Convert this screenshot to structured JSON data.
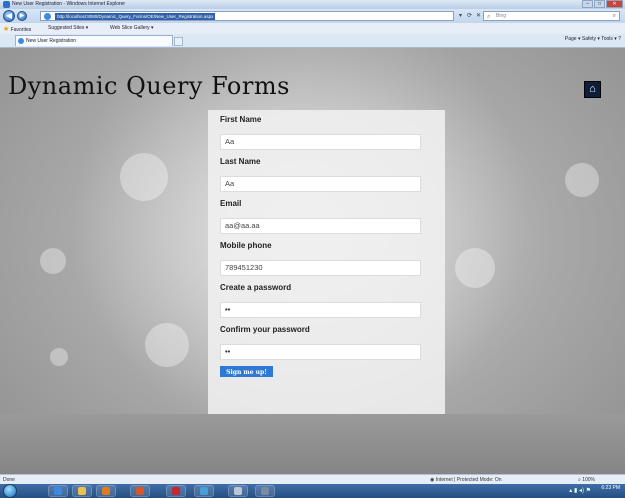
{
  "window": {
    "title": "New User Registration - Windows Internet Explorer",
    "controls": {
      "minimize": "–",
      "maximize": "□",
      "close": "✕"
    }
  },
  "browser": {
    "back": "◀",
    "forward": "▶",
    "url": "http://localhost:8080/Dynamic_Query_Forms/OE/New_User_Registration.aspx",
    "search_placeholder": "Bing",
    "addr_buttons": [
      "▾",
      "⟳",
      "✕"
    ],
    "favorites_label": "Favorites",
    "favorites_items": [
      "Suggested Sites ▾",
      "Web Slice Gallery ▾"
    ],
    "tab_label": "New User Registration",
    "command_bar": "Page ▾   Safety ▾   Tools ▾   ?",
    "status_left": "Done",
    "status_zone": "Internet | Protected Mode: On",
    "zoom": "100%"
  },
  "page": {
    "site_title": "Dynamic Query Forms",
    "home_icon": "⌂"
  },
  "form": {
    "fields": [
      {
        "label": "First Name",
        "value": "Aa"
      },
      {
        "label": "Last Name",
        "value": "Aa"
      },
      {
        "label": "Email",
        "value": "aa@aa.aa"
      },
      {
        "label": "Mobile phone",
        "value": "789451230"
      },
      {
        "label": "Create a password",
        "value": "••"
      },
      {
        "label": "Confirm your password",
        "value": "••"
      }
    ],
    "submit_label": "Sign me up!"
  },
  "taskbar": {
    "clock_time": "6:23 PM"
  },
  "colors": {
    "accent": "#2f79d6",
    "home_button_bg": "#0c1e3a"
  }
}
